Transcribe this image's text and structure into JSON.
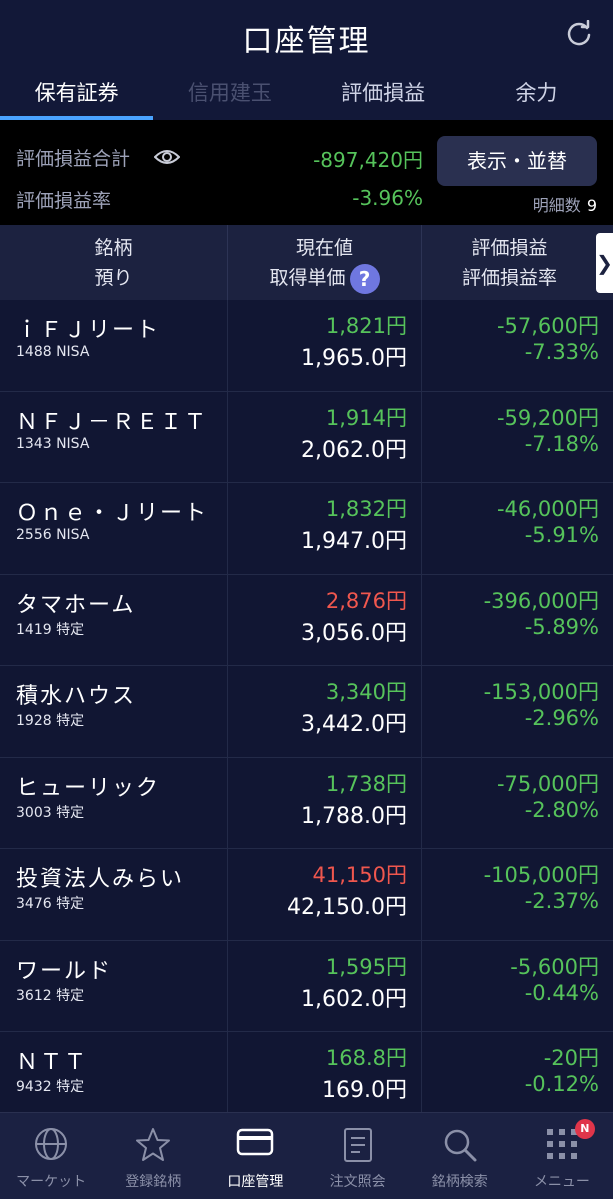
{
  "header": {
    "title": "口座管理"
  },
  "tabs": [
    {
      "label": "保有証券",
      "state": "active"
    },
    {
      "label": "信用建玉",
      "state": "disabled"
    },
    {
      "label": "評価損益",
      "state": "normal"
    },
    {
      "label": "余力",
      "state": "normal"
    }
  ],
  "summary": {
    "total_label": "評価損益合計",
    "total_value": "-897,420円",
    "rate_label": "評価損益率",
    "rate_value": "-3.96%",
    "sort_button": "表示・並替",
    "count_label": "明細数",
    "count_value": "9"
  },
  "table_header": {
    "col1_line1": "銘柄",
    "col1_line2": "預り",
    "col2_line1": "現在値",
    "col2_line2": "取得単価",
    "col3_line1": "評価損益",
    "col3_line2": "評価損益率",
    "help": "?",
    "scroll": "❯"
  },
  "holdings": [
    {
      "name": "ｉＦＪリート",
      "code": "1488 NISA",
      "price": "1,821円",
      "price_color": "green",
      "cost": "1,965.0円",
      "pl": "-57,600円",
      "rate": "-7.33%"
    },
    {
      "name": "ＮＦＪ－ＲＥＩＴ",
      "code": "1343 NISA",
      "price": "1,914円",
      "price_color": "green",
      "cost": "2,062.0円",
      "pl": "-59,200円",
      "rate": "-7.18%"
    },
    {
      "name": "Ｏｎｅ・Ｊリート",
      "code": "2556 NISA",
      "price": "1,832円",
      "price_color": "green",
      "cost": "1,947.0円",
      "pl": "-46,000円",
      "rate": "-5.91%"
    },
    {
      "name": "タマホーム",
      "code": "1419 特定",
      "price": "2,876円",
      "price_color": "red",
      "cost": "3,056.0円",
      "pl": "-396,000円",
      "rate": "-5.89%"
    },
    {
      "name": "積水ハウス",
      "code": "1928 特定",
      "price": "3,340円",
      "price_color": "green",
      "cost": "3,442.0円",
      "pl": "-153,000円",
      "rate": "-2.96%"
    },
    {
      "name": "ヒューリック",
      "code": "3003 特定",
      "price": "1,738円",
      "price_color": "green",
      "cost": "1,788.0円",
      "pl": "-75,000円",
      "rate": "-2.80%"
    },
    {
      "name": "投資法人みらい",
      "code": "3476 特定",
      "price": "41,150円",
      "price_color": "red",
      "cost": "42,150.0円",
      "pl": "-105,000円",
      "rate": "-2.37%"
    },
    {
      "name": "ワールド",
      "code": "3612 特定",
      "price": "1,595円",
      "price_color": "green",
      "cost": "1,602.0円",
      "pl": "-5,600円",
      "rate": "-0.44%"
    },
    {
      "name": "ＮＴＴ",
      "code": "9432 特定",
      "price": "168.8円",
      "price_color": "green",
      "cost": "169.0円",
      "pl": "-20円",
      "rate": "-0.12%"
    }
  ],
  "bottom_nav": [
    {
      "label": "マーケット",
      "icon": "globe-icon"
    },
    {
      "label": "登録銘柄",
      "icon": "star-icon"
    },
    {
      "label": "口座管理",
      "icon": "card-icon",
      "active": true
    },
    {
      "label": "注文照会",
      "icon": "document-icon"
    },
    {
      "label": "銘柄検索",
      "icon": "search-icon"
    },
    {
      "label": "メニュー",
      "icon": "grid-icon",
      "badge": "N"
    }
  ],
  "colors": {
    "gain_loss_green": "#56c35b",
    "price_up_red": "#f0574e",
    "accent_blue": "#4aa3ff"
  }
}
